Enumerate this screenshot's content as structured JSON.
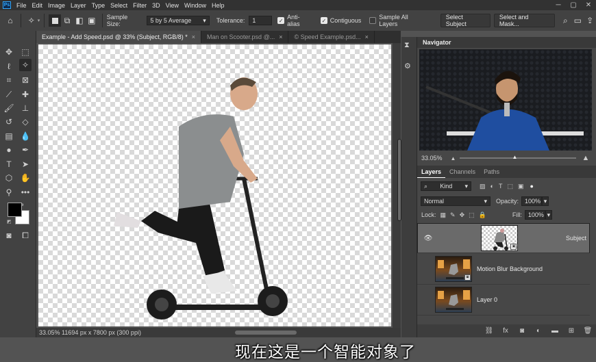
{
  "app": {
    "logo": "Ps"
  },
  "menu": [
    "File",
    "Edit",
    "Image",
    "Layer",
    "Type",
    "Select",
    "Filter",
    "3D",
    "View",
    "Window",
    "Help"
  ],
  "window_controls": [
    "─",
    "▢",
    "✕"
  ],
  "options": {
    "sample_size_label": "Sample Size:",
    "sample_size_value": "5 by 5 Average",
    "tolerance_label": "Tolerance:",
    "tolerance_value": "1",
    "anti_alias": "Anti-alias",
    "contiguous": "Contiguous",
    "sample_all_layers": "Sample All Layers",
    "select_subject": "Select Subject",
    "select_and_mask": "Select and Mask..."
  },
  "tabs": [
    {
      "label": "Example - Add Speed.psd @ 33% (Subject, RGB/8) *",
      "close": "×"
    },
    {
      "label": "Man on Scooter.psd @...",
      "close": "×"
    },
    {
      "label": "© Speed Example.psd...",
      "close": "×"
    }
  ],
  "status": "33.05%  11694 px x 7800 px (300 ppi)",
  "subtitle": "现在这是一个智能对象了",
  "navigator": {
    "title": "Navigator",
    "zoom": "33.05%"
  },
  "layers_panel": {
    "tabs": [
      "Layers",
      "Channels",
      "Paths"
    ],
    "filter_kind": "Kind",
    "blend_mode": "Normal",
    "opacity_label": "Opacity:",
    "opacity_value": "100%",
    "lock_label": "Lock:",
    "fill_label": "Fill:",
    "fill_value": "100%",
    "layers": [
      {
        "name": "Subject",
        "visible": true,
        "selected": true
      },
      {
        "name": "Motion Blur Background",
        "visible": false,
        "selected": false
      },
      {
        "name": "Layer 0",
        "visible": false,
        "selected": false
      }
    ]
  },
  "colors": {
    "accent": "#31a8ff",
    "ui_dark": "#323232",
    "ui_mid": "#424242",
    "panel": "#474747"
  }
}
